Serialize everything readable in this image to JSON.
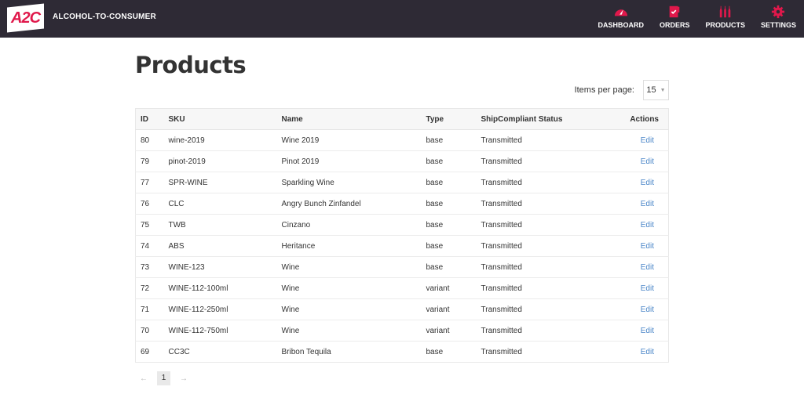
{
  "brand": {
    "logo": "A2C",
    "name": "ALCOHOL-TO-CONSUMER"
  },
  "nav": [
    {
      "label": "DASHBOARD",
      "icon": "gauge-icon"
    },
    {
      "label": "ORDERS",
      "icon": "clipboard-check-icon"
    },
    {
      "label": "PRODUCTS",
      "icon": "bottles-icon"
    },
    {
      "label": "SETTINGS",
      "icon": "gear-icon"
    }
  ],
  "accent": "#e0184b",
  "page": {
    "title": "Products",
    "items_per_page_label": "Items per page:",
    "items_per_page": "15"
  },
  "table": {
    "headers": [
      "ID",
      "SKU",
      "Name",
      "Type",
      "ShipCompliant Status",
      "Actions"
    ],
    "rows": [
      [
        "80",
        "wine-2019",
        "Wine 2019",
        "base",
        "Transmitted",
        "Edit"
      ],
      [
        "79",
        "pinot-2019",
        "Pinot 2019",
        "base",
        "Transmitted",
        "Edit"
      ],
      [
        "77",
        "SPR-WINE",
        "Sparkling Wine",
        "base",
        "Transmitted",
        "Edit"
      ],
      [
        "76",
        "CLC",
        "Angry Bunch Zinfandel",
        "base",
        "Transmitted",
        "Edit"
      ],
      [
        "75",
        "TWB",
        "Cinzano",
        "base",
        "Transmitted",
        "Edit"
      ],
      [
        "74",
        "ABS",
        "Heritance",
        "base",
        "Transmitted",
        "Edit"
      ],
      [
        "73",
        "WINE-123",
        "Wine",
        "base",
        "Transmitted",
        "Edit"
      ],
      [
        "72",
        "WINE-112-100ml",
        "Wine",
        "variant",
        "Transmitted",
        "Edit"
      ],
      [
        "71",
        "WINE-112-250ml",
        "Wine",
        "variant",
        "Transmitted",
        "Edit"
      ],
      [
        "70",
        "WINE-112-750ml",
        "Wine",
        "variant",
        "Transmitted",
        "Edit"
      ],
      [
        "69",
        "CC3C",
        "Bribon Tequila",
        "base",
        "Transmitted",
        "Edit"
      ]
    ]
  },
  "pagination": {
    "prev": "←",
    "current": "1",
    "next": "→"
  }
}
